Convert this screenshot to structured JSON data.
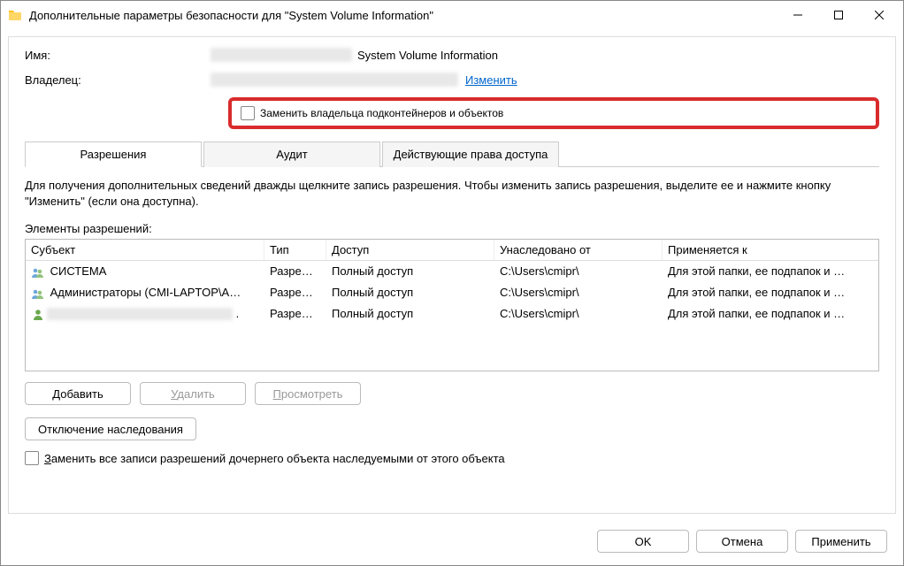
{
  "titlebar": {
    "title": "Дополнительные параметры безопасности  для \"System Volume Information\""
  },
  "info": {
    "name_label": "Имя:",
    "name_value": "System Volume Information",
    "owner_label": "Владелец:",
    "change_link": "Изменить"
  },
  "highlight_checkbox": {
    "label": "Заменить владельца подконтейнеров и объектов"
  },
  "tabs": {
    "permissions": "Разрешения",
    "audit": "Аудит",
    "effective": "Действующие права доступа"
  },
  "description": "Для получения дополнительных сведений дважды щелкните запись разрешения. Чтобы изменить запись разрешения, выделите ее и нажмите кнопку \"Изменить\" (если она доступна).",
  "perm_list_label": "Элементы разрешений:",
  "columns": {
    "subject": "Субъект",
    "type": "Тип",
    "access": "Доступ",
    "inherited": "Унаследовано от",
    "applies": "Применяется к"
  },
  "rows": [
    {
      "subject": "СИСТЕМА",
      "type": "Разре…",
      "access": "Полный доступ",
      "inherited": "C:\\Users\\cmipr\\",
      "applies": "Для этой папки, ее подпапок и …",
      "icon": "group"
    },
    {
      "subject": "Администраторы (CMI-LAPTOP\\А…",
      "type": "Разре…",
      "access": "Полный доступ",
      "inherited": "C:\\Users\\cmipr\\",
      "applies": "Для этой папки, ее подпапок и …",
      "icon": "group"
    },
    {
      "subject": "",
      "type": "Разре…",
      "access": "Полный доступ",
      "inherited": "C:\\Users\\cmipr\\",
      "applies": "Для этой папки, ее подпапок и …",
      "icon": "user",
      "blurred": true
    }
  ],
  "buttons": {
    "add": "Добавить",
    "remove": "Удалить",
    "view": "Просмотреть",
    "disable_inherit": "Отключение наследования"
  },
  "replace_all_checkbox": "Заменить все записи разрешений дочернего объекта наследуемыми от этого объекта",
  "dialog_buttons": {
    "ok": "OK",
    "cancel": "Отмена",
    "apply": "Применить"
  }
}
